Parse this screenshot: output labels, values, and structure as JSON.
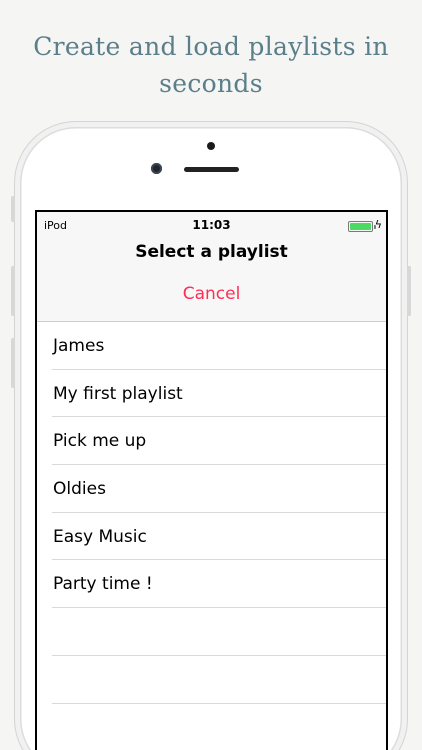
{
  "promo": {
    "headline_line1": "Create and load playlists in",
    "headline_line2": "seconds"
  },
  "status_bar": {
    "carrier": "iPod",
    "time": "11:03",
    "battery_charge_fraction": 1.0,
    "charging_icon": "bolt-icon"
  },
  "sheet": {
    "title": "Select a playlist",
    "cancel_label": "Cancel"
  },
  "playlists": [
    {
      "label": "James"
    },
    {
      "label": "My first playlist"
    },
    {
      "label": "Pick me up"
    },
    {
      "label": "Oldies"
    },
    {
      "label": "Easy Music"
    },
    {
      "label": "Party time !"
    },
    {
      "label": ""
    },
    {
      "label": ""
    },
    {
      "label": ""
    }
  ],
  "colors": {
    "headline": "#5a7e8a",
    "cancel": "#ff2d55",
    "battery": "#4cd964"
  }
}
